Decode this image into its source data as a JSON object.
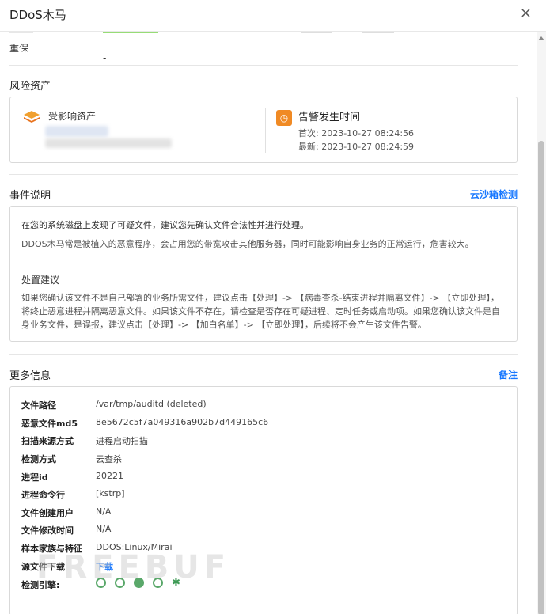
{
  "dialog": {
    "title": "DDoS木马",
    "close": "×"
  },
  "top_row": {
    "key": "重保",
    "value": "--"
  },
  "risk_assets": {
    "title": "风险资产",
    "asset_label": "受影响资产",
    "alarm_label": "告警发生时间",
    "first_label": "首次:",
    "first_time": "2023-10-27 08:24:56",
    "last_label": "最新:",
    "last_time": "2023-10-27 08:24:59"
  },
  "event": {
    "title": "事件说明",
    "link": "云沙箱检测",
    "line1": "在您的系统磁盘上发现了可疑文件，建议您先确认文件合法性并进行处理。",
    "line2": "DDOS木马常是被植入的恶意程序，会占用您的带宽攻击其他服务器，同时可能影响自身业务的正常运行，危害较大。",
    "sub_title": "处置建议",
    "advice": "如果您确认该文件不是自己部署的业务所需文件，建议点击【处理】-> 【病毒查杀-结束进程并隔离文件】-> 【立即处理】，将终止恶意进程并隔离恶意文件。如果该文件不存在，请检查是否存在可疑进程、定时任务或启动项。如果您确认该文件是自身业务文件，是误报，建议点击【处理】-> 【加白名单】-> 【立即处理】，后续将不会产生该文件告警。"
  },
  "more_info": {
    "title": "更多信息",
    "link": "备注",
    "rows": [
      {
        "key": "文件路径",
        "value": "/var/tmp/auditd (deleted)"
      },
      {
        "key": "恶意文件md5",
        "value": "8e5672c5f7a049316a902b7d449165c6"
      },
      {
        "key": "扫描来源方式",
        "value": "进程启动扫描"
      },
      {
        "key": "检测方式",
        "value": "云查杀"
      },
      {
        "key": "进程id",
        "value": "20221"
      },
      {
        "key": "进程命令行",
        "value": "[kstrp]"
      },
      {
        "key": "文件创建用户",
        "value": "N/A"
      },
      {
        "key": "文件修改时间",
        "value": "N/A"
      },
      {
        "key": "样本家族与特征",
        "value": "DDOS:Linux/Mirai"
      },
      {
        "key": "源文件下载",
        "value": "下载"
      },
      {
        "key": "检测引擎:",
        "value": ""
      }
    ]
  },
  "engine_icons": [
    "engine-icon-1",
    "engine-icon-2",
    "engine-icon-3",
    "engine-icon-4",
    "engine-icon-5"
  ],
  "watermark": "FREEBUF",
  "colors": {
    "accent": "#1677ff",
    "orange": "#f08a24",
    "green": "#5aa86a"
  }
}
